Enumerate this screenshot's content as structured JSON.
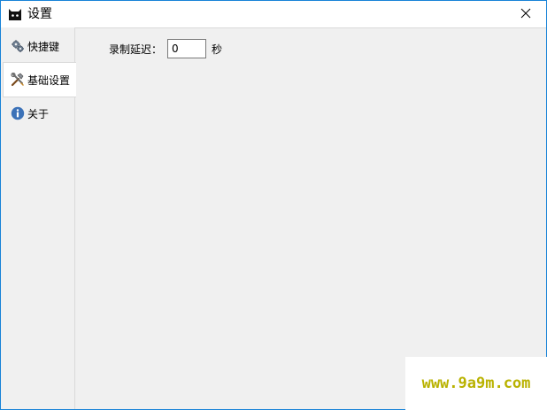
{
  "window": {
    "title": "设置",
    "accent_color": "#1883d7"
  },
  "tabs": [
    {
      "label": "快捷键",
      "icon": "gears-icon",
      "selected": false
    },
    {
      "label": "基础设置",
      "icon": "tools-icon",
      "selected": true
    },
    {
      "label": "关于",
      "icon": "info-icon",
      "selected": false
    }
  ],
  "basic_settings": {
    "delay_label": "录制延迟：",
    "delay_value": "0",
    "delay_unit": "秒"
  },
  "watermark": {
    "text": "www.9a9m.com"
  }
}
